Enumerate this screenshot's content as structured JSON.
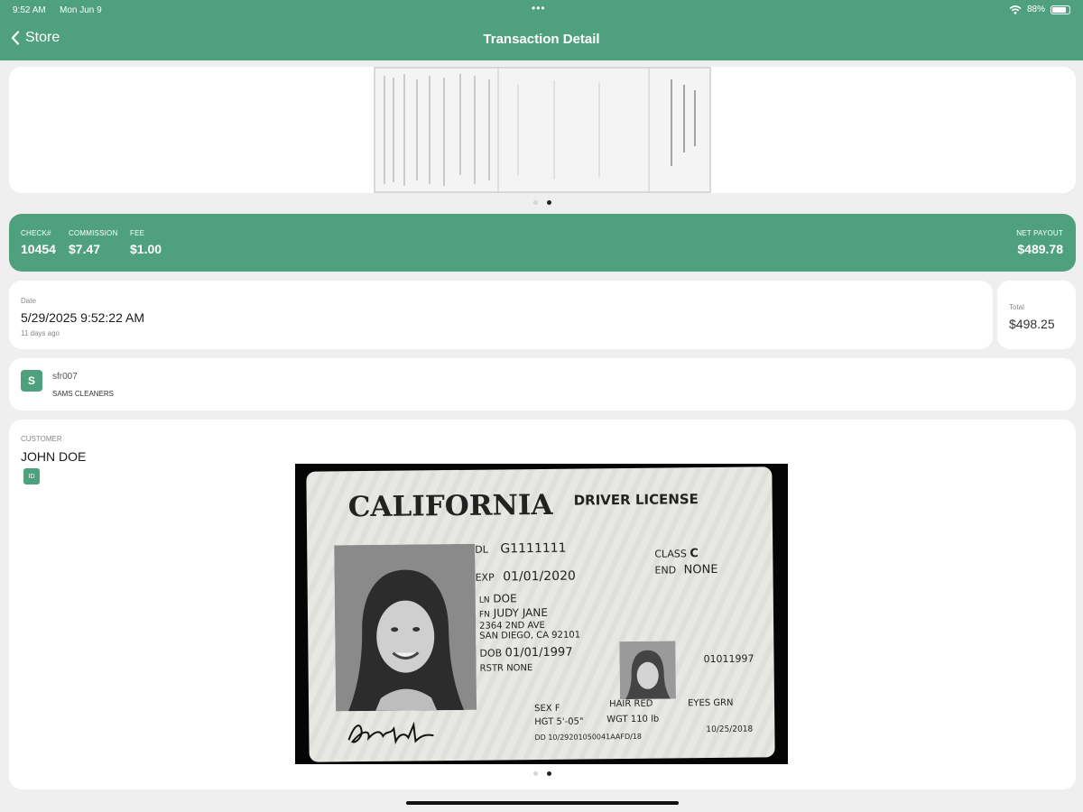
{
  "status_bar": {
    "time": "9:52 AM",
    "date": "Mon Jun 9",
    "battery": "88%"
  },
  "nav": {
    "back_label": "Store",
    "title": "Transaction Detail"
  },
  "summary": {
    "check_label": "CHECK#",
    "check_value": "10454",
    "commission_label": "COMMISSION",
    "commission_value": "$7.47",
    "fee_label": "FEE",
    "fee_value": "$1.00",
    "net_label": "NET PAYOUT",
    "net_value": "$489.78"
  },
  "date_card": {
    "label": "Date",
    "value": "5/29/2025 9:52:22 AM",
    "relative": "11 days ago"
  },
  "total_card": {
    "label": "Total",
    "value": "$498.25"
  },
  "store": {
    "avatar_letter": "S",
    "code": "sfr007",
    "name": "SAMS CLEANERS"
  },
  "customer": {
    "label": "CUSTOMER",
    "name": "JOHN DOE",
    "id_badge": "ID"
  },
  "license": {
    "state": "CALIFORNIA",
    "type": "DRIVER LICENSE",
    "dl_label": "DL",
    "dl": "G1111111",
    "exp_label": "EXP",
    "exp": "01/01/2020",
    "class_label": "CLASS",
    "class": "C",
    "end_label": "END",
    "end": "NONE",
    "ln_label": "LN",
    "ln": "DOE",
    "fn_label": "FN",
    "fn": "JUDY JANE",
    "address1": "2364 2ND AVE",
    "address2": "SAN DIEGO, CA 92101",
    "dob_label": "DOB",
    "dob": "01/01/1997",
    "rstr_label": "RSTR",
    "rstr": "NONE",
    "number": "01011997",
    "sex_label": "SEX",
    "sex": "F",
    "hair_label": "HAIR",
    "hair": "RED",
    "eyes_label": "EYES",
    "eyes": "GRN",
    "hgt_label": "HGT",
    "hgt": "5'-05\"",
    "wgt_label": "WGT",
    "wgt": "110 lb",
    "dd_label": "DD",
    "dd": "10/29201050041AAFD/18",
    "iss": "10/25/2018"
  },
  "colors": {
    "accent": "#4fa07f",
    "background": "#efefef"
  },
  "icons": {
    "back": "chevron-left-icon",
    "wifi": "wifi-icon",
    "battery": "battery-icon"
  }
}
